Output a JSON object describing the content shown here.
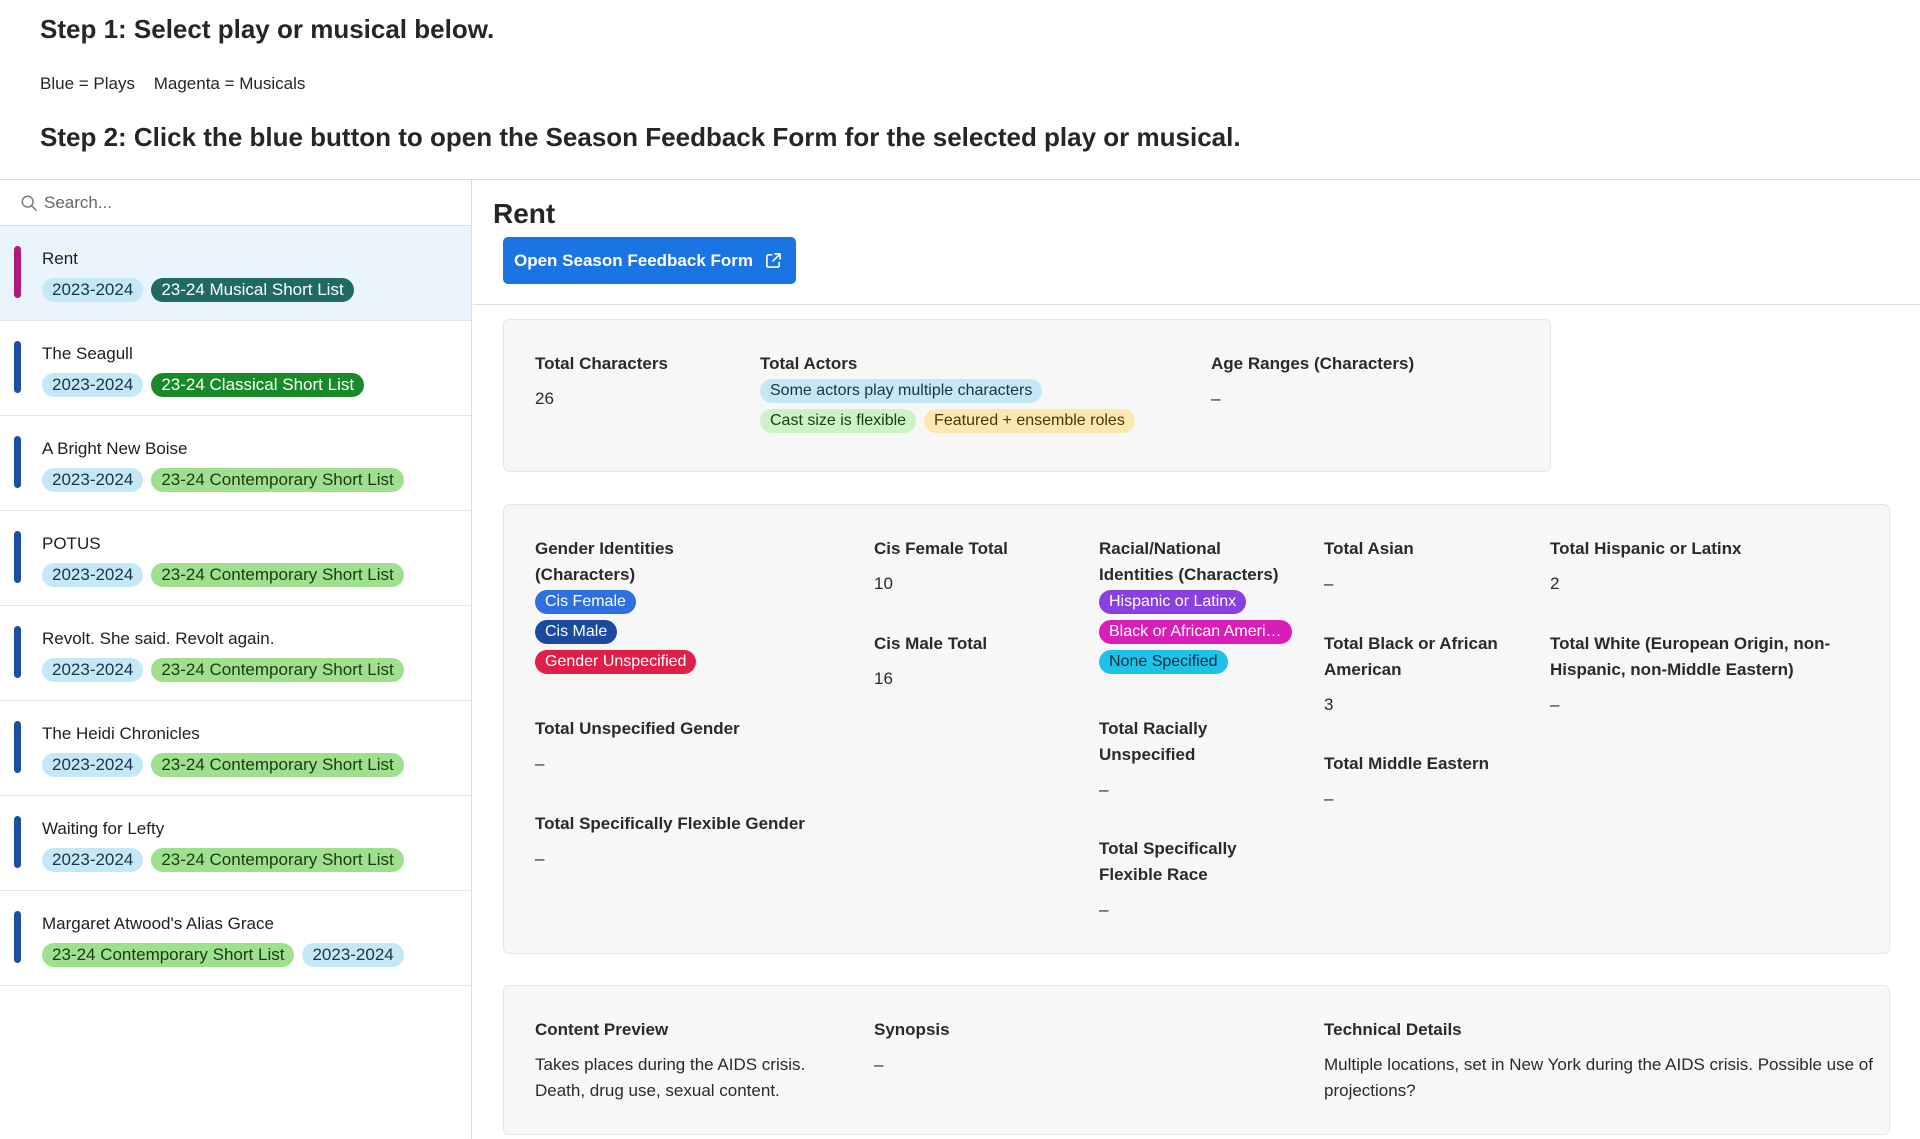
{
  "instructions": {
    "step1": "Step 1: Select play or musical below.",
    "legend_plays": "Blue = Plays",
    "legend_musicals": "Magenta = Musicals",
    "step2": "Step 2: Click the blue button to open the Season Feedback Form for the selected play or musical."
  },
  "search": {
    "placeholder": "Search..."
  },
  "colors": {
    "play": "#1a4fa3",
    "musical": "#b0177f",
    "button": "#1b74e4"
  },
  "records": [
    {
      "name": "Rent",
      "kind": "musical",
      "tags": [
        {
          "label": "2023-2024",
          "style": "t-year"
        },
        {
          "label": "23-24 Musical Short List",
          "style": "t-musical"
        }
      ]
    },
    {
      "name": "The Seagull",
      "kind": "play",
      "tags": [
        {
          "label": "2023-2024",
          "style": "t-year"
        },
        {
          "label": "23-24 Classical Short List",
          "style": "t-classical"
        }
      ]
    },
    {
      "name": "A Bright New Boise",
      "kind": "play",
      "tags": [
        {
          "label": "2023-2024",
          "style": "t-year"
        },
        {
          "label": "23-24 Contemporary Short List",
          "style": "t-contemp"
        }
      ]
    },
    {
      "name": "POTUS",
      "kind": "play",
      "tags": [
        {
          "label": "2023-2024",
          "style": "t-year"
        },
        {
          "label": "23-24 Contemporary Short List",
          "style": "t-contemp"
        }
      ]
    },
    {
      "name": "Revolt. She said. Revolt again.",
      "kind": "play",
      "tags": [
        {
          "label": "2023-2024",
          "style": "t-year"
        },
        {
          "label": "23-24 Contemporary Short List",
          "style": "t-contemp"
        }
      ]
    },
    {
      "name": "The Heidi Chronicles",
      "kind": "play",
      "tags": [
        {
          "label": "2023-2024",
          "style": "t-year"
        },
        {
          "label": "23-24 Contemporary Short List",
          "style": "t-contemp"
        }
      ]
    },
    {
      "name": "Waiting for Lefty",
      "kind": "play",
      "tags": [
        {
          "label": "2023-2024",
          "style": "t-year"
        },
        {
          "label": "23-24 Contemporary Short List",
          "style": "t-contemp"
        }
      ]
    },
    {
      "name": "Margaret Atwood's Alias Grace",
      "kind": "play",
      "tags": [
        {
          "label": "23-24 Contemporary Short List",
          "style": "t-contemp"
        },
        {
          "label": "2023-2024",
          "style": "t-year"
        }
      ]
    }
  ],
  "detail": {
    "title": "Rent",
    "button_label": "Open Season Feedback Form",
    "total_characters": {
      "label": "Total Characters",
      "value": "26"
    },
    "total_actors": {
      "label": "Total Actors",
      "pills": [
        "Some actors play multiple characters",
        "Cast size is flexible",
        "Featured + ensemble roles"
      ]
    },
    "age_ranges": {
      "label": "Age Ranges (Characters)",
      "value": "–"
    },
    "gender_identities": {
      "label": "Gender Identities (Characters)",
      "pills": [
        "Cis Female",
        "Cis Male",
        "Gender Unspecified"
      ]
    },
    "total_unspecified_gender": {
      "label": "Total Unspecified Gender",
      "value": "–"
    },
    "total_flexible_gender": {
      "label": "Total Specifically Flexible Gender",
      "value": "–"
    },
    "cis_female_total": {
      "label": "Cis Female Total",
      "value": "10"
    },
    "cis_male_total": {
      "label": "Cis Male Total",
      "value": "16"
    },
    "racial_identities": {
      "label": "Racial/National Identities (Characters)",
      "pills": [
        "Hispanic or Latinx",
        "Black or African American",
        "None Specified"
      ]
    },
    "total_racially_unspecified": {
      "label": "Total Racially Unspecified",
      "value": "–"
    },
    "total_flexible_race": {
      "label": "Total Specifically Flexible Race",
      "value": "–"
    },
    "total_asian": {
      "label": "Total Asian",
      "value": "–"
    },
    "total_black": {
      "label": "Total Black or African American",
      "value": "3"
    },
    "total_middle_eastern": {
      "label": "Total Middle Eastern",
      "value": "–"
    },
    "total_hispanic": {
      "label": "Total Hispanic or Latinx",
      "value": "2"
    },
    "total_white": {
      "label": "Total White (European Origin, non-Hispanic, non-Middle Eastern)",
      "value": "–"
    },
    "content_preview": {
      "label": "Content Preview",
      "value": "Takes places during the AIDS crisis. Death, drug use, sexual content."
    },
    "synopsis": {
      "label": "Synopsis",
      "value": "–"
    },
    "technical_details": {
      "label": "Technical Details",
      "value": "Multiple locations, set in New York during the AIDS crisis. Possible use of projections?"
    }
  }
}
